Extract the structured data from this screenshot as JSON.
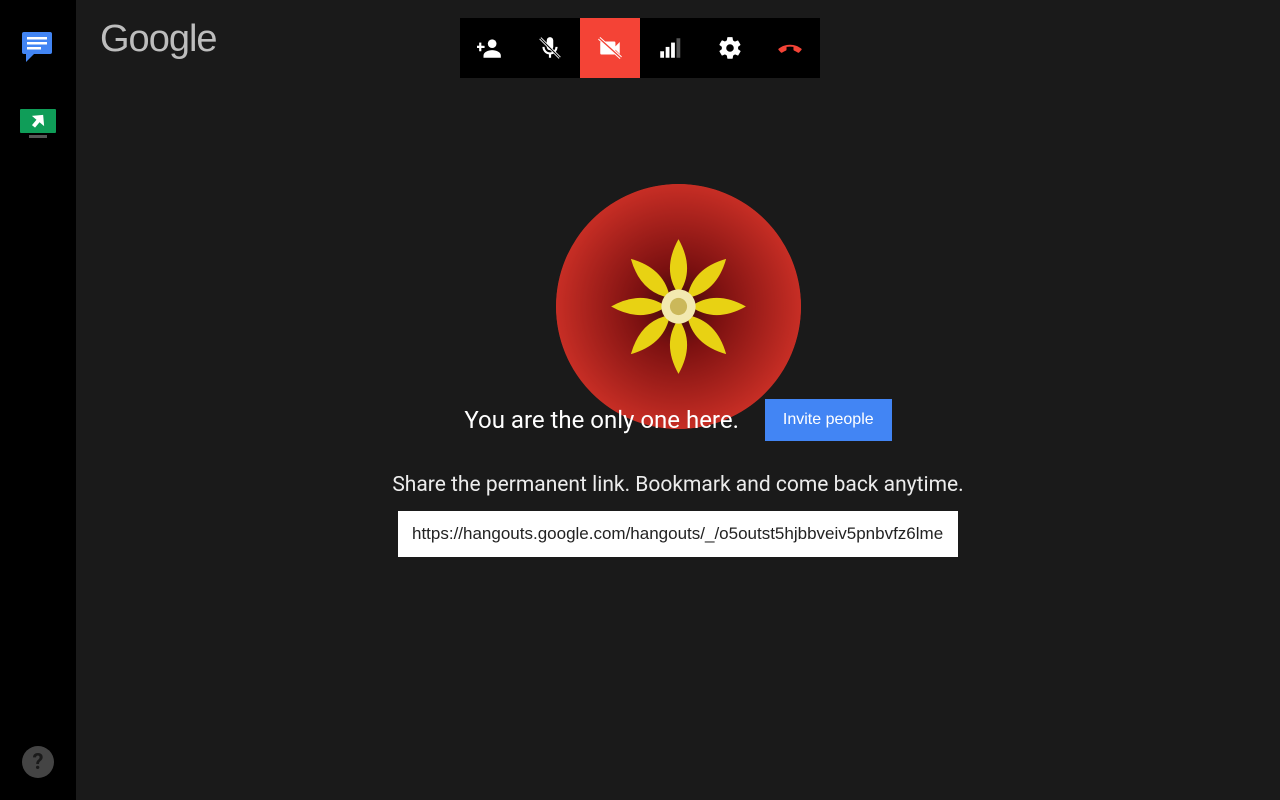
{
  "app": {
    "logo_text": "Google"
  },
  "sidebar": {
    "chat_label": "chat",
    "screenshare_label": "screenshare",
    "help_label": "?"
  },
  "controls": {
    "camera_active": true
  },
  "center": {
    "only_one_msg": "You are the only one here.",
    "invite_label": "Invite people",
    "share_msg": "Share the permanent link. Bookmark and come back anytime.",
    "link_value": "https://hangouts.google.com/hangouts/_/o5outst5hjbbveiv5pnbvfz6lme"
  },
  "colors": {
    "accent_red": "#f44336",
    "accent_blue": "#4285f4"
  }
}
